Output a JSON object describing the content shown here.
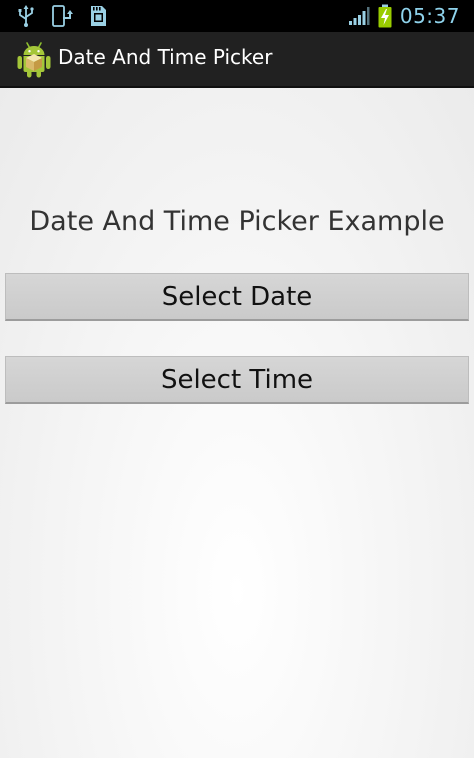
{
  "status_bar": {
    "time": "05:37",
    "icons_left": [
      "usb-icon",
      "phone-sync-icon",
      "sd-card-icon"
    ],
    "icons_right": [
      "signal-icon",
      "battery-charging-icon"
    ]
  },
  "action_bar": {
    "title": "Date And Time Picker",
    "icon": "android-app-icon"
  },
  "main": {
    "heading": "Date And Time Picker Example",
    "select_date_label": "Select Date",
    "select_time_label": "Select Time"
  },
  "colors": {
    "status_bar_bg": "#000000",
    "status_icon": "#8fd3ec",
    "action_bar_bg": "#212121",
    "button_bg": "#d0d0d0",
    "android_green": "#a4c639"
  }
}
